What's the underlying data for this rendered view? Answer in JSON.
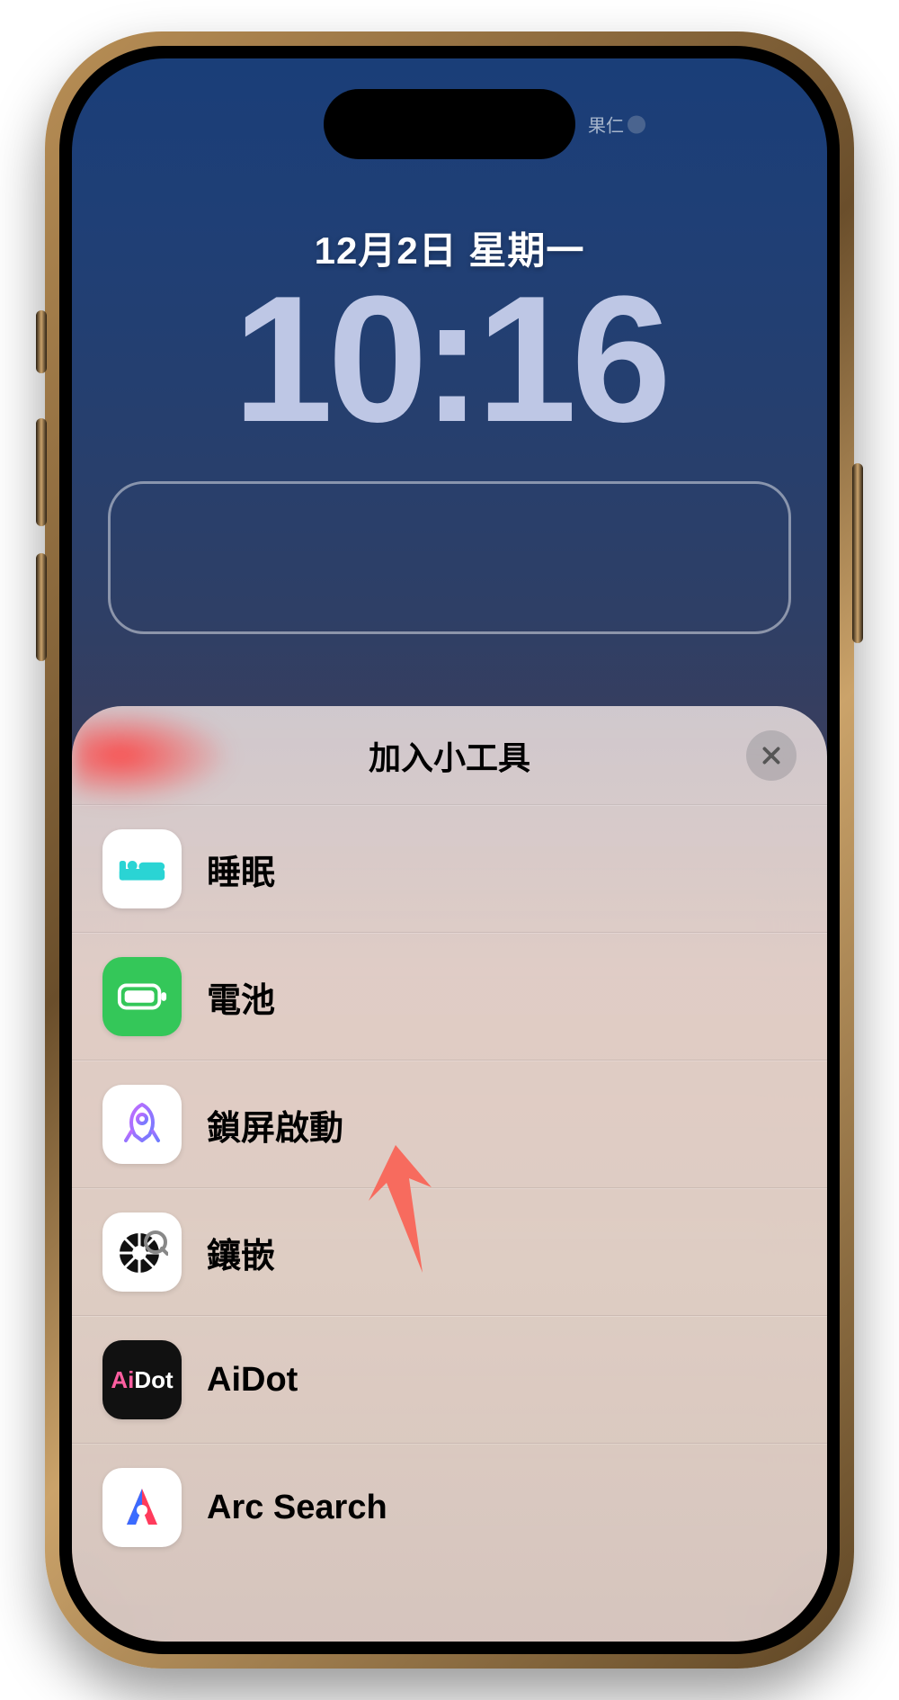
{
  "island": {
    "label": "果仁"
  },
  "lock": {
    "date": "12月2日 星期一",
    "time": "10:16"
  },
  "sheet": {
    "title": "加入小工具",
    "items": [
      {
        "id": "sleep",
        "label": "睡眠",
        "icon": "bed-icon"
      },
      {
        "id": "battery",
        "label": "電池",
        "icon": "battery-icon"
      },
      {
        "id": "lock",
        "label": "鎖屏啟動",
        "icon": "rocket-icon"
      },
      {
        "id": "embed",
        "label": "鑲嵌",
        "icon": "wheel-icon"
      },
      {
        "id": "aidot",
        "label": "AiDot",
        "icon": "aidot-icon"
      },
      {
        "id": "arc",
        "label": "Arc Search",
        "icon": "arc-icon"
      }
    ]
  }
}
